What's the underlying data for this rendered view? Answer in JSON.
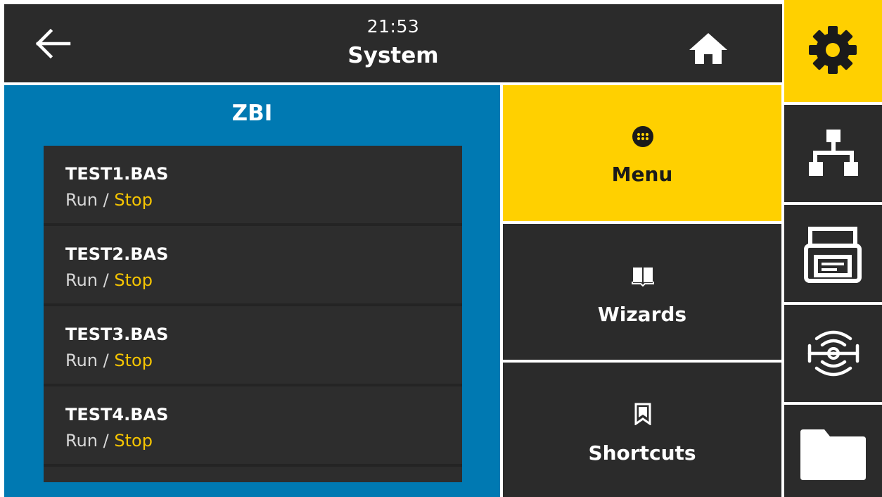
{
  "header": {
    "time": "21:53",
    "title": "System",
    "back_icon": "arrow-left-icon",
    "home_icon": "home-icon"
  },
  "zbi": {
    "title": "ZBI",
    "programs": [
      {
        "name": "TEST1.BAS",
        "run_label": "Run",
        "separator": " / ",
        "stop_label": "Stop"
      },
      {
        "name": "TEST2.BAS",
        "run_label": "Run",
        "separator": " / ",
        "stop_label": "Stop"
      },
      {
        "name": "TEST3.BAS",
        "run_label": "Run",
        "separator": " / ",
        "stop_label": "Stop"
      },
      {
        "name": "TEST4.BAS",
        "run_label": "Run",
        "separator": " / ",
        "stop_label": "Stop"
      }
    ]
  },
  "middle_nav": [
    {
      "label": "Menu",
      "icon": "menu-grid-icon",
      "active": true
    },
    {
      "label": "Wizards",
      "icon": "book-icon",
      "active": false
    },
    {
      "label": "Shortcuts",
      "icon": "bookmark-icon",
      "active": false
    }
  ],
  "side_nav": [
    {
      "icon": "gear-icon",
      "active": true
    },
    {
      "icon": "network-icon",
      "active": false
    },
    {
      "icon": "printer-icon",
      "active": false
    },
    {
      "icon": "rfid-icon",
      "active": false
    },
    {
      "icon": "folder-icon",
      "active": false
    }
  ],
  "colors": {
    "accent": "#ffd000",
    "panel_blue": "#0079b2",
    "dark": "#2b2b2b",
    "stop_text": "#f6c500"
  }
}
